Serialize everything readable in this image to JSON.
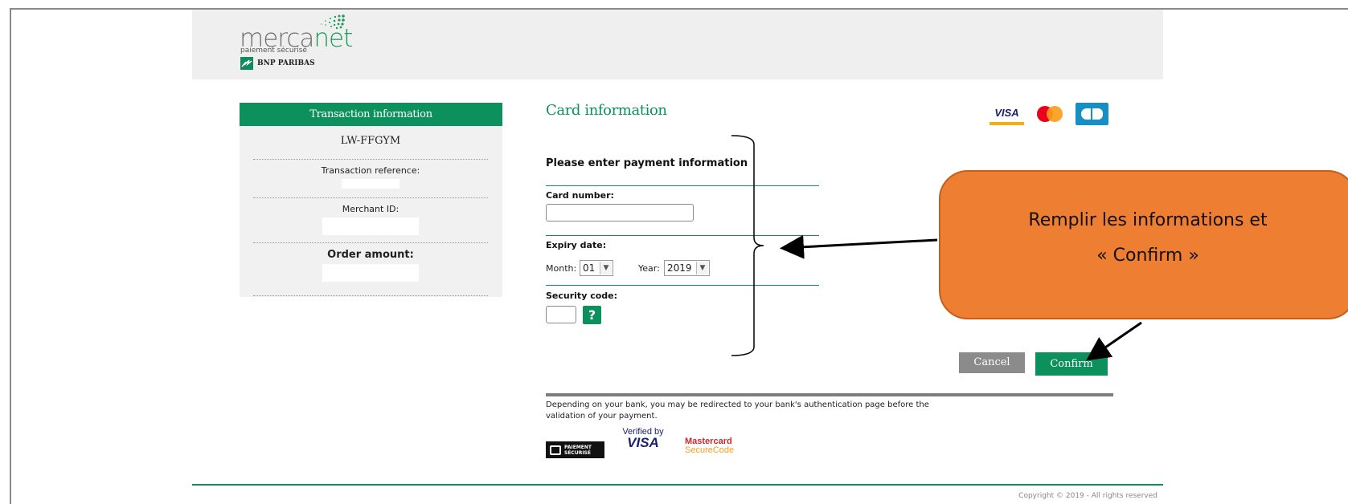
{
  "header": {
    "logo_text_a": "merca",
    "logo_text_b": "net",
    "logo_subtitle": "paiement sécurisé",
    "bank_name": "BNP PARIBAS"
  },
  "transaction": {
    "title": "Transaction information",
    "order_id": "LW-FFGYM",
    "reference_label": "Transaction reference:",
    "merchant_label": "Merchant ID:",
    "amount_label": "Order amount:"
  },
  "card": {
    "title": "Card information",
    "brands": [
      "VISA",
      "mastercard",
      "CB"
    ],
    "prompt": "Please enter payment information",
    "card_number_label": "Card number:",
    "card_number_value": "",
    "expiry_label": "Expiry date:",
    "month_label": "Month:",
    "month_value": "01",
    "year_label": "Year:",
    "year_value": "2019",
    "security_label": "Security code:",
    "security_value": "",
    "help_label": "?"
  },
  "actions": {
    "cancel": "Cancel",
    "confirm": "Confirm"
  },
  "notice": {
    "text": "Depending on your bank, you may be redirected to your bank's authentication page before the validation of your payment.",
    "secure_badge_a": "PAIEMENT",
    "secure_badge_b": "SÉCURISÉ",
    "vbv_line1": "Verified by",
    "vbv_line2": "VISA",
    "mc_line1": "Mastercard",
    "mc_line2": "SecureCode"
  },
  "footer": {
    "copyright": "Copyright © 2019 - All rights reserved"
  },
  "annotation": {
    "line1": "Remplir les informations et",
    "line2": "« Confirm »",
    "color": "#ee7e31"
  },
  "colors": {
    "brand_green": "#0c915d",
    "header_bg": "#efefef"
  }
}
